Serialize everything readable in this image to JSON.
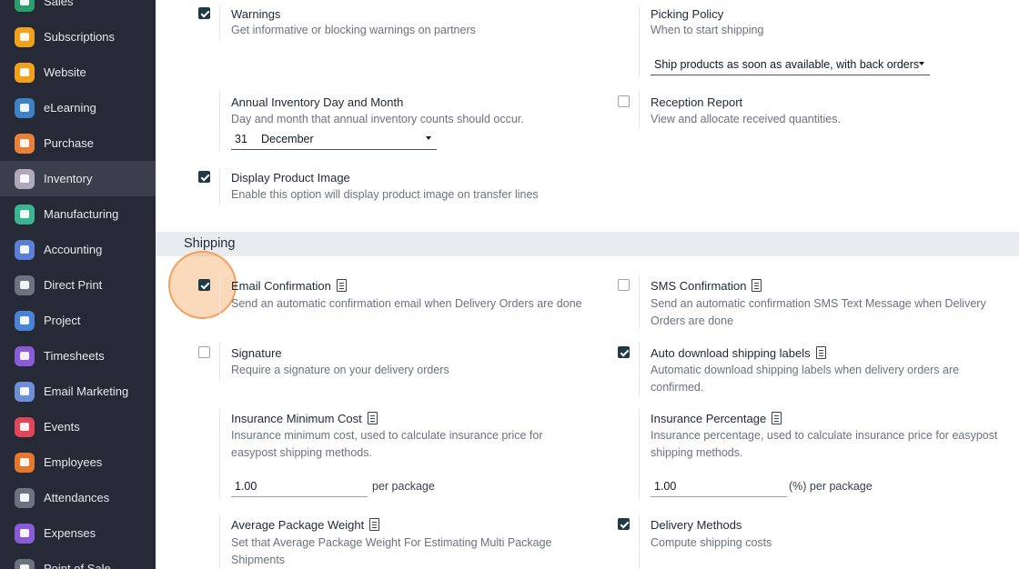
{
  "sidebar": {
    "items": [
      {
        "label": "Sales",
        "color": "#2e9d6e"
      },
      {
        "label": "Subscriptions",
        "color": "#f0a21c"
      },
      {
        "label": "Website",
        "color": "#f0a21c"
      },
      {
        "label": "eLearning",
        "color": "#3d82c4"
      },
      {
        "label": "Purchase",
        "color": "#e8803a"
      },
      {
        "label": "Inventory",
        "color": "#b0a8bd"
      },
      {
        "label": "Manufacturing",
        "color": "#3bb58f"
      },
      {
        "label": "Accounting",
        "color": "#5a7fd6"
      },
      {
        "label": "Direct Print",
        "color": "#6b7280"
      },
      {
        "label": "Project",
        "color": "#4a83d6"
      },
      {
        "label": "Timesheets",
        "color": "#8a5bd6"
      },
      {
        "label": "Email Marketing",
        "color": "#6c8fd6"
      },
      {
        "label": "Events",
        "color": "#e0465a"
      },
      {
        "label": "Employees",
        "color": "#e2782e"
      },
      {
        "label": "Attendances",
        "color": "#6b7280"
      },
      {
        "label": "Expenses",
        "color": "#8a5bd6"
      },
      {
        "label": "Point of Sale",
        "color": "#6b7280"
      }
    ],
    "active": "Inventory"
  },
  "settings": {
    "warnings": {
      "title": "Warnings",
      "desc": "Get informative or blocking warnings on partners",
      "checked": true
    },
    "picking_policy": {
      "title": "Picking Policy",
      "desc": "When to start shipping",
      "value": "Ship products as soon as available, with back orders"
    },
    "annual_inventory": {
      "title": "Annual Inventory Day and Month",
      "desc": "Day and month that annual inventory counts should occur.",
      "day": "31",
      "month": "December"
    },
    "reception_report": {
      "title": "Reception Report",
      "desc": "View and allocate received quantities.",
      "checked": false
    },
    "display_product_image": {
      "title": "Display Product Image",
      "desc": "Enable this option will display product image on transfer lines",
      "checked": true
    }
  },
  "shipping": {
    "section_title": "Shipping",
    "email_confirmation": {
      "title": "Email Confirmation",
      "desc": "Send an automatic confirmation email when Delivery Orders are done",
      "checked": true
    },
    "sms_confirmation": {
      "title": "SMS Confirmation",
      "desc": "Send an automatic confirmation SMS Text Message when Delivery Orders are done",
      "checked": false
    },
    "signature": {
      "title": "Signature",
      "desc": "Require a signature on your delivery orders",
      "checked": false
    },
    "auto_download_labels": {
      "title": "Auto download shipping labels",
      "desc": "Automatic download shipping labels when delivery orders are confirmed.",
      "checked": true
    },
    "insurance_min_cost": {
      "title": "Insurance Minimum Cost",
      "desc": "Insurance minimum cost, used to calculate insurance price for easypost shipping methods.",
      "value": "1.00",
      "unit": "per package"
    },
    "insurance_percentage": {
      "title": "Insurance Percentage",
      "desc": "Insurance percentage, used to calculate insurance price for easypost shipping methods.",
      "value": "1.00",
      "unit": "(%) per package"
    },
    "avg_package_weight": {
      "title": "Average Package Weight",
      "desc": "Set that Average Package Weight For Estimating Multi Package Shipments"
    },
    "delivery_methods": {
      "title": "Delivery Methods",
      "desc": "Compute shipping costs",
      "checked": true
    }
  }
}
